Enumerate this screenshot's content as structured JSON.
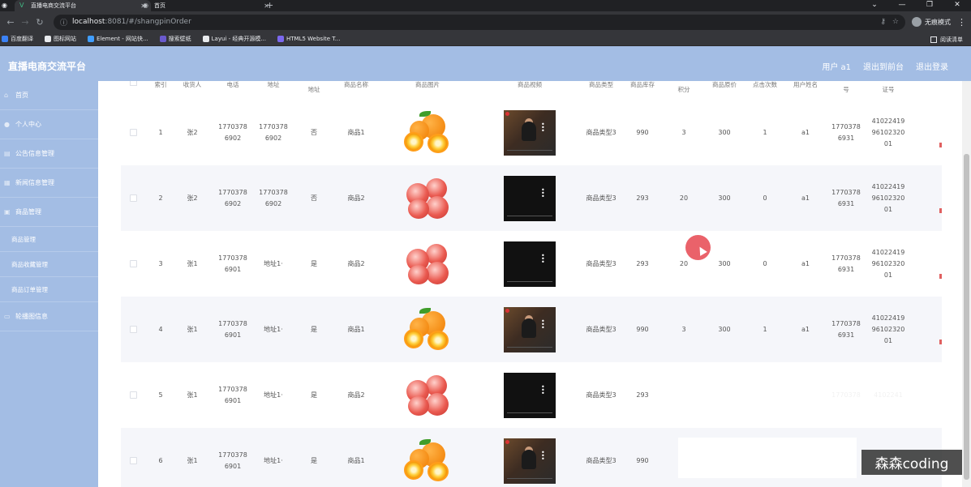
{
  "browser": {
    "tabs": [
      {
        "title": "直播电商交流平台",
        "active": true
      },
      {
        "title": "首页",
        "active": false
      }
    ],
    "url_host": "localhost",
    "url_path": ":8081/#/shangpinOrder",
    "incognito_label": "无痕模式",
    "bookmarks": [
      "百度翻译",
      "图标网站",
      "Element - 网站快...",
      "搜索壁纸",
      "Layui - 经典开源模...",
      "HTML5 Website T..."
    ],
    "reading_list": "阅读清单"
  },
  "header": {
    "title": "直播电商交流平台",
    "links": [
      "用户 a1",
      "退出到前台",
      "退出登录"
    ]
  },
  "sidebar": {
    "items": [
      {
        "label": "首页",
        "type": "item"
      },
      {
        "label": "个人中心",
        "type": "item"
      },
      {
        "label": "公告信息管理",
        "type": "item"
      },
      {
        "label": "新闻信息管理",
        "type": "item"
      },
      {
        "label": "商品管理",
        "type": "item"
      },
      {
        "label": "商品管理",
        "type": "sub"
      },
      {
        "label": "商品收藏管理",
        "type": "sub"
      },
      {
        "label": "商品订单管理",
        "type": "sub"
      },
      {
        "label": "轮播图信息",
        "type": "item"
      }
    ]
  },
  "table": {
    "headers": [
      "索引",
      "收货人",
      "电话",
      "地址",
      "地址",
      "商品名称",
      "商品图片",
      "商品视频",
      "商品类型",
      "商品库存",
      "积分",
      "商品原价",
      "点击次数",
      "用户姓名",
      "号",
      "证号"
    ],
    "rows": [
      {
        "idx": "1",
        "receiver": "张2",
        "phone": "17703786902",
        "address": "17703786902",
        "default": "否",
        "name": "商品1",
        "img": "orange",
        "video": "person",
        "type": "商品类型3",
        "stock": "990",
        "points": "3",
        "price": "300",
        "clicks": "1",
        "user": "a1",
        "uphone": "17703786931",
        "idcard": "410224199610232001"
      },
      {
        "idx": "2",
        "receiver": "张2",
        "phone": "17703786902",
        "address": "17703786902",
        "default": "否",
        "name": "商品2",
        "img": "apple",
        "video": "dark",
        "type": "商品类型3",
        "stock": "293",
        "points": "20",
        "price": "300",
        "clicks": "0",
        "user": "a1",
        "uphone": "17703786931",
        "idcard": "410224199610232001"
      },
      {
        "idx": "3",
        "receiver": "张1",
        "phone": "17703786901",
        "address": "地址1·",
        "default": "是",
        "name": "商品2",
        "img": "apple",
        "video": "dark",
        "type": "商品类型3",
        "stock": "293",
        "points": "20",
        "price": "300",
        "clicks": "0",
        "user": "a1",
        "uphone": "17703786931",
        "idcard": "410224199610232001"
      },
      {
        "idx": "4",
        "receiver": "张1",
        "phone": "17703786901",
        "address": "地址1·",
        "default": "是",
        "name": "商品1",
        "img": "orange",
        "video": "person",
        "type": "商品类型3",
        "stock": "990",
        "points": "3",
        "price": "300",
        "clicks": "1",
        "user": "a1",
        "uphone": "17703786931",
        "idcard": "410224199610232001"
      },
      {
        "idx": "5",
        "receiver": "张1",
        "phone": "17703786901",
        "address": "地址1·",
        "default": "是",
        "name": "商品2",
        "img": "apple",
        "video": "dark",
        "type": "商品类型3",
        "stock": "293",
        "points": "",
        "price": "",
        "clicks": "",
        "user": "",
        "uphone": "1770378",
        "idcard": "4102241"
      },
      {
        "idx": "6",
        "receiver": "张1",
        "phone": "17703786901",
        "address": "地址1·",
        "default": "是",
        "name": "商品1",
        "img": "orange",
        "video": "person",
        "type": "商品类型3",
        "stock": "990",
        "points": "",
        "price": "",
        "clicks": "",
        "user": "",
        "uphone": "",
        "idcard": ""
      }
    ]
  },
  "watermark": "森森coding"
}
